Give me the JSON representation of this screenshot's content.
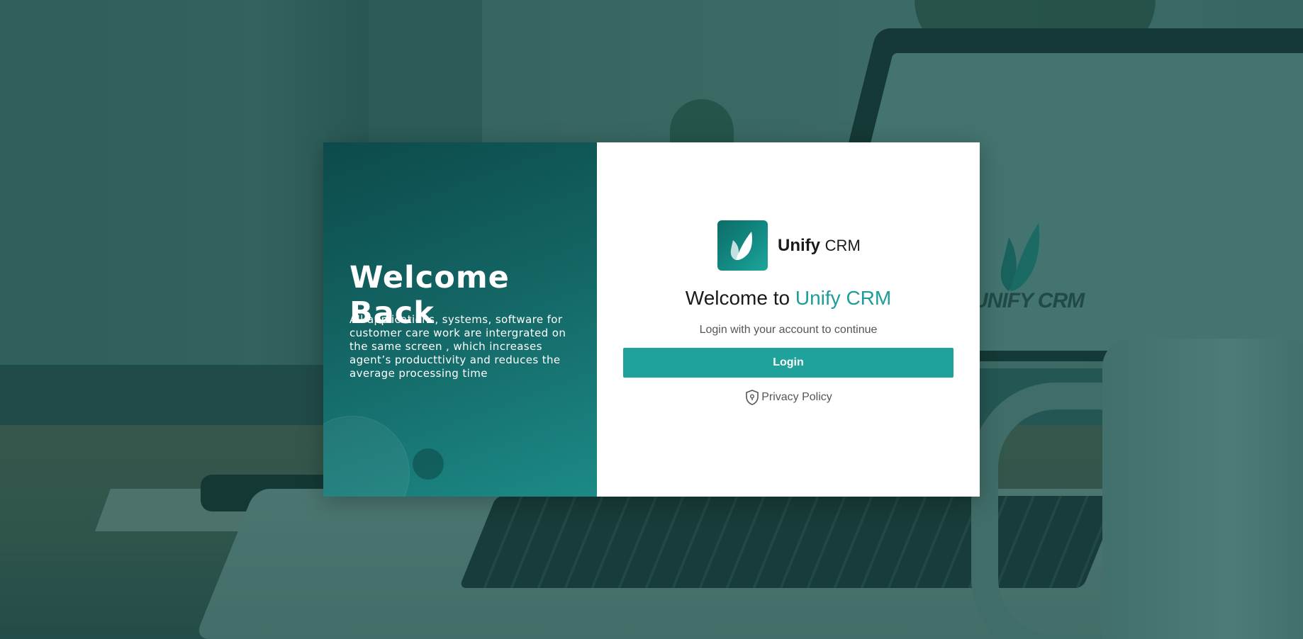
{
  "left_panel": {
    "title": "Welcome Back",
    "description": "All applications, systems, software for customer care work are intergrated on the same screen , which increases agent’s producttivity and reduces the average processing time"
  },
  "brand": {
    "name_bold": "Unify",
    "name_light": "CRM",
    "logo_icon": "leaf-j-icon"
  },
  "login_card": {
    "welcome_prefix": "Welcome to",
    "welcome_brand": "Unify CRM",
    "subtitle": "Login with your account to continue",
    "login_button": "Login",
    "privacy_link": "Privacy Policy",
    "privacy_icon": "shield-location-icon"
  },
  "background": {
    "screen_logo_text": "UNIFY CRM"
  },
  "colors": {
    "accent": "#1e9c98",
    "button": "#1fa19c",
    "panel_dark": "#0d4a4b"
  }
}
